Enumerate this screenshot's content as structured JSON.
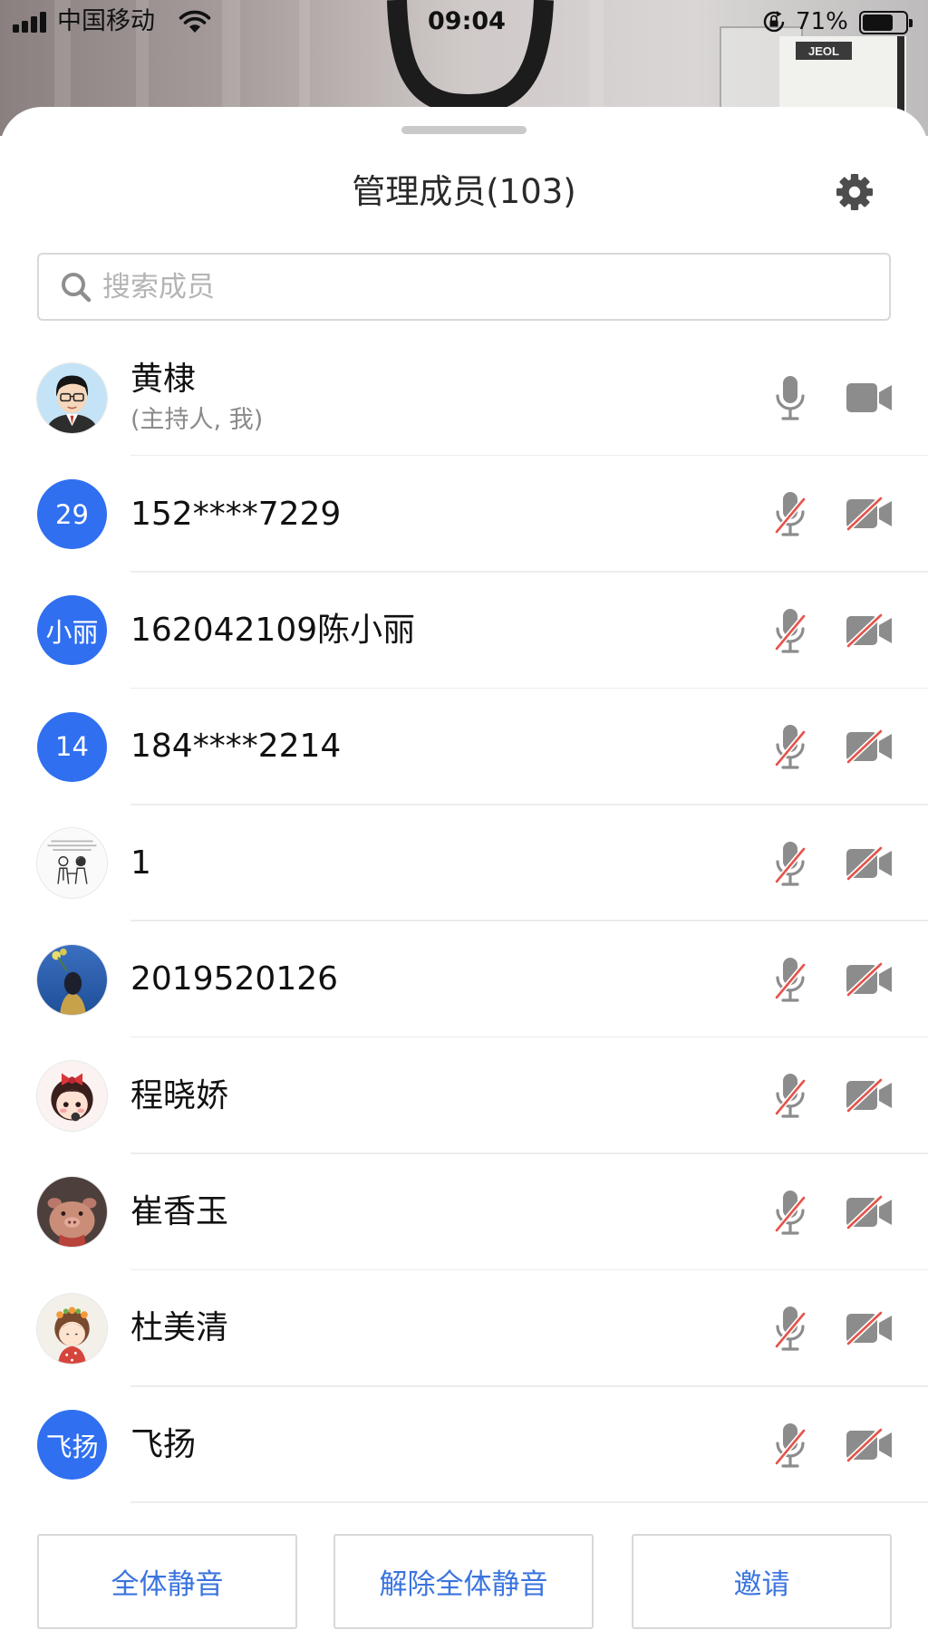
{
  "status_bar": {
    "carrier": "中国移动",
    "time": "09:04",
    "battery_text": "71%",
    "battery_level": 0.71,
    "signal_icon": "signal-icon",
    "wifi_icon": "wifi-icon",
    "rotation_lock_icon": "rotation-lock-icon",
    "battery_icon": "battery-icon"
  },
  "background": {
    "label_text": "JEOL"
  },
  "sheet": {
    "title": "管理成员(103)",
    "settings_icon": "gear-icon",
    "search": {
      "icon": "search-icon",
      "placeholder": "搜索成员",
      "value": ""
    },
    "members": [
      {
        "name": "黄棣",
        "subtitle": "(主持人, 我)",
        "avatar_icon": "cartoon-man-avatar",
        "mic_muted": false,
        "camera_off": false
      },
      {
        "name": "152****7229",
        "avatar_text": "29",
        "mic_muted": true,
        "camera_off": true
      },
      {
        "name": "162042109陈小丽",
        "avatar_text": "小丽",
        "mic_muted": true,
        "camera_off": true
      },
      {
        "name": "184****2214",
        "avatar_text": "14",
        "mic_muted": true,
        "camera_off": true
      },
      {
        "name": "1",
        "avatar_icon": "comic-sketch-avatar",
        "mic_muted": true,
        "camera_off": true
      },
      {
        "name": "2019520126",
        "avatar_icon": "blue-photo-avatar",
        "mic_muted": true,
        "camera_off": true
      },
      {
        "name": "程晓娇",
        "avatar_icon": "cartoon-girl-avatar",
        "mic_muted": true,
        "camera_off": true
      },
      {
        "name": "崔香玉",
        "avatar_icon": "cartoon-pig-avatar",
        "mic_muted": true,
        "camera_off": true
      },
      {
        "name": "杜美清",
        "avatar_icon": "flower-girl-avatar",
        "mic_muted": true,
        "camera_off": true
      },
      {
        "name": "飞扬",
        "avatar_text": "飞扬",
        "mic_muted": true,
        "camera_off": true
      }
    ],
    "actions": {
      "mute_all": "全体静音",
      "unmute_all": "解除全体静音",
      "invite": "邀请"
    }
  },
  "colors": {
    "accent": "#2f6ff0",
    "action_text": "#3a74df",
    "icon_gray": "#8c8c8c",
    "muted_slash": "#e5534b",
    "divider": "#ececec"
  }
}
